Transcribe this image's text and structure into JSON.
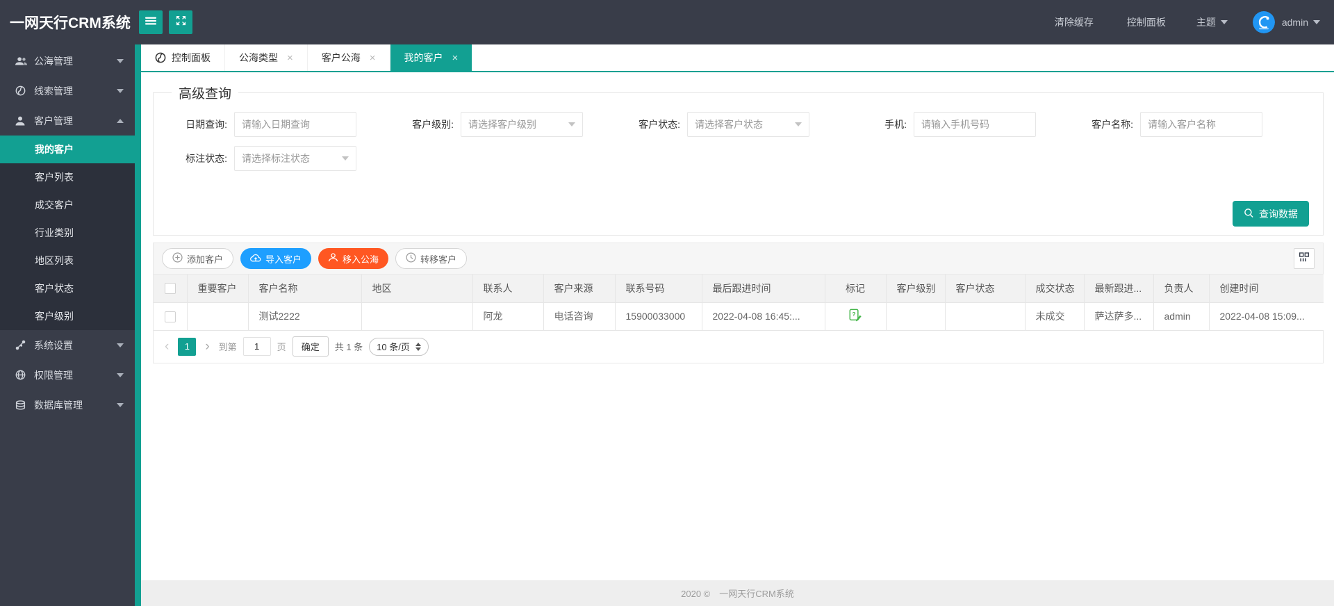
{
  "app": {
    "title": "一网天行CRM系统"
  },
  "header": {
    "clear_cache": "清除缓存",
    "control_panel": "控制面板",
    "theme": "主题",
    "username": "admin"
  },
  "sidebar": {
    "items": [
      {
        "label": "公海管理",
        "icon": "users-icon",
        "state": "collapsed"
      },
      {
        "label": "线索管理",
        "icon": "globe-icon",
        "state": "collapsed"
      },
      {
        "label": "客户管理",
        "icon": "user-icon",
        "state": "expanded",
        "active_child": "我的客户",
        "children": [
          "我的客户",
          "客户列表",
          "成交客户",
          "行业类别",
          "地区列表",
          "客户状态",
          "客户级别"
        ]
      },
      {
        "label": "系统设置",
        "icon": "share-nodes-icon",
        "state": "collapsed"
      },
      {
        "label": "权限管理",
        "icon": "globe-grid-icon",
        "state": "collapsed"
      },
      {
        "label": "数据库管理",
        "icon": "database-icon",
        "state": "collapsed"
      }
    ]
  },
  "tabs": [
    {
      "label": "控制面板",
      "icon": "globe",
      "closable": false,
      "active": false
    },
    {
      "label": "公海类型",
      "closable": true,
      "active": false
    },
    {
      "label": "客户公海",
      "closable": true,
      "active": false
    },
    {
      "label": "我的客户",
      "closable": true,
      "active": true
    }
  ],
  "icons": {
    "close_glyph": "×"
  },
  "query": {
    "legend": "高级查询",
    "search_button": "查询数据",
    "fields": [
      {
        "label": "日期查询:",
        "type": "input",
        "placeholder": "请输入日期查询",
        "value": ""
      },
      {
        "label": "客户级别:",
        "type": "select",
        "placeholder": "请选择客户级别"
      },
      {
        "label": "客户状态:",
        "type": "select",
        "placeholder": "请选择客户状态"
      },
      {
        "label": "手机:",
        "type": "input",
        "placeholder": "请输入手机号码",
        "value": ""
      },
      {
        "label": "客户名称:",
        "type": "input",
        "placeholder": "请输入客户名称",
        "value": ""
      },
      {
        "label": "标注状态:",
        "type": "select",
        "placeholder": "请选择标注状态"
      }
    ]
  },
  "toolbar": {
    "buttons": [
      {
        "label": "添加客户",
        "icon": "plus-circle-icon",
        "style": "default"
      },
      {
        "label": "导入客户",
        "icon": "upload-cloud-icon",
        "style": "blue"
      },
      {
        "label": "移入公海",
        "icon": "user-move-icon",
        "style": "red"
      },
      {
        "label": "转移客户",
        "icon": "clock-icon",
        "style": "default"
      }
    ]
  },
  "table": {
    "columns": [
      "重要客户",
      "客户名称",
      "地区",
      "联系人",
      "客户来源",
      "联系号码",
      "最后跟进时间",
      "标记",
      "客户级别",
      "客户状态",
      "成交状态",
      "最新跟进...",
      "负责人",
      "创建时间"
    ],
    "rows": [
      {
        "cells": [
          "",
          "测试2222",
          "",
          "阿龙",
          "电话咨询",
          "15900033000",
          "2022-04-08 16:45:...",
          "[mark-icon]",
          "",
          "",
          "未成交",
          "萨达萨多...",
          "admin",
          "2022-04-08 15:09..."
        ]
      }
    ]
  },
  "pagination": {
    "prev": "‹",
    "current_page": "1",
    "next": "›",
    "goto_label": "到第",
    "page_value": "1",
    "page_unit": "页",
    "confirm": "确定",
    "total": "共 1 条",
    "page_size": "10 条/页"
  },
  "footer": {
    "text": "2020 ©　一网天行CRM系统"
  },
  "colors": {
    "accent": "#12A092",
    "sidebar_dark": "#393D49",
    "button_blue": "#1E9FFF",
    "button_red": "#FF5722",
    "mark_green": "#44B549"
  }
}
